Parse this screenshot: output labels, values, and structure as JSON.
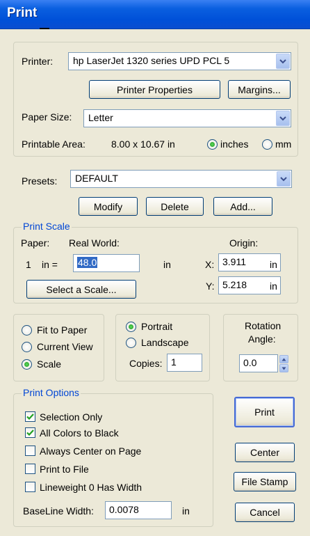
{
  "window": {
    "title": "Print"
  },
  "printer": {
    "label": "Printer:",
    "value": "hp LaserJet 1320 series UPD PCL 5",
    "properties_button": "Printer Properties",
    "margins_button": "Margins...",
    "paper_size_label": "Paper Size:",
    "paper_size_value": "Letter",
    "printable_area_label": "Printable Area:",
    "printable_area_value": "8.00 x 10.67 in",
    "unit_inches": "inches",
    "unit_mm": "mm"
  },
  "presets": {
    "label": "Presets:",
    "value": "DEFAULT",
    "modify_button": "Modify",
    "delete_button": "Delete",
    "add_button": "Add..."
  },
  "print_scale": {
    "title": "Print Scale",
    "paper_label": "Paper:",
    "real_world_label": "Real World:",
    "origin_label": "Origin:",
    "one": "1",
    "in_eq": "in =",
    "scale_value": "48.0",
    "scale_unit": "in",
    "x_label": "X:",
    "x_value": "3.911",
    "x_unit": "in",
    "y_label": "Y:",
    "y_value": "5.218",
    "y_unit": "in",
    "select_scale_button": "Select a Scale..."
  },
  "fit": {
    "fit_to_paper": "Fit to Paper",
    "current_view": "Current View",
    "scale": "Scale"
  },
  "orientation": {
    "portrait": "Portrait",
    "landscape": "Landscape",
    "copies_label": "Copies:",
    "copies_value": "1"
  },
  "rotation": {
    "label_line1": "Rotation",
    "label_line2": "Angle:",
    "value": "0.0"
  },
  "print_options": {
    "title": "Print Options",
    "selection_only": "Selection Only",
    "all_colors_black": "All Colors to Black",
    "always_center": "Always Center on Page",
    "print_to_file": "Print to File",
    "lineweight_zero": "Lineweight 0 Has Width",
    "baseline_label": "BaseLine Width:",
    "baseline_value": "0.0078",
    "baseline_unit": "in"
  },
  "actions": {
    "print": "Print",
    "center": "Center",
    "file_stamp": "File Stamp",
    "cancel": "Cancel"
  }
}
